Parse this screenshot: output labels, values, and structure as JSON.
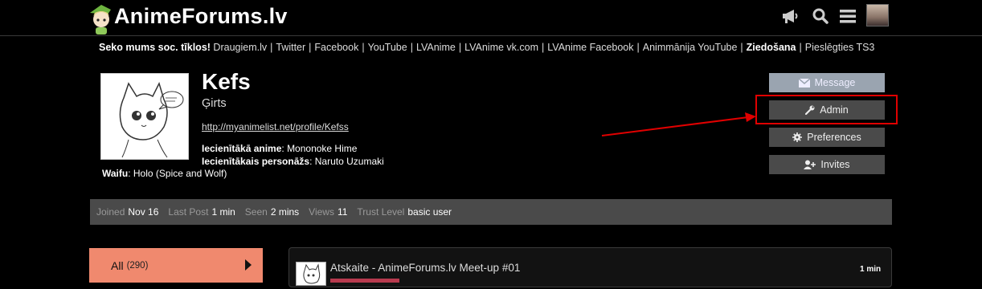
{
  "header": {
    "logo_text": "AnimeForums.lv",
    "icons": [
      "megaphone-icon",
      "search-icon",
      "hamburger-menu-icon"
    ]
  },
  "social": {
    "lead": "Seko mums soc. tīklos!",
    "links": [
      "Draugiem.lv",
      "Twitter",
      "Facebook",
      "YouTube",
      "LVAnime",
      "LVAnime vk.com",
      "LVAnime Facebook",
      "Animmānija YouTube"
    ],
    "donate": "Ziedošana",
    "ts3": "Pieslēgties TS3"
  },
  "profile": {
    "username": "Kefs",
    "real_name": "Ģirts",
    "website": "http://myanimelist.net/profile/Kefss",
    "fav_anime_label": "Iecienītākā anime",
    "fav_anime": "Mononoke Hime",
    "fav_char_label": "Iecienītākais personāžs",
    "fav_char": "Naruto Uzumaki",
    "waifu_label": "Waifu",
    "waifu": "Holo (Spice and Wolf)"
  },
  "buttons": {
    "message": "Message",
    "admin": "Admin",
    "preferences": "Preferences",
    "invites": "Invites"
  },
  "stats": {
    "joined_label": "Joined",
    "joined": "Nov 16",
    "last_post_label": "Last Post",
    "last_post": "1 min",
    "seen_label": "Seen",
    "seen": "2 mins",
    "views_label": "Views",
    "views": "11",
    "trust_label": "Trust Level",
    "trust": "basic user"
  },
  "nav": {
    "all_label": "All",
    "all_count": "(290)"
  },
  "post": {
    "title": "Atskaite - AnimeForums.lv Meet-up #01",
    "time": "1 min",
    "category_color": "#b73a4e"
  },
  "colors": {
    "accent": "#f0896e",
    "annotation": "#e00000"
  }
}
